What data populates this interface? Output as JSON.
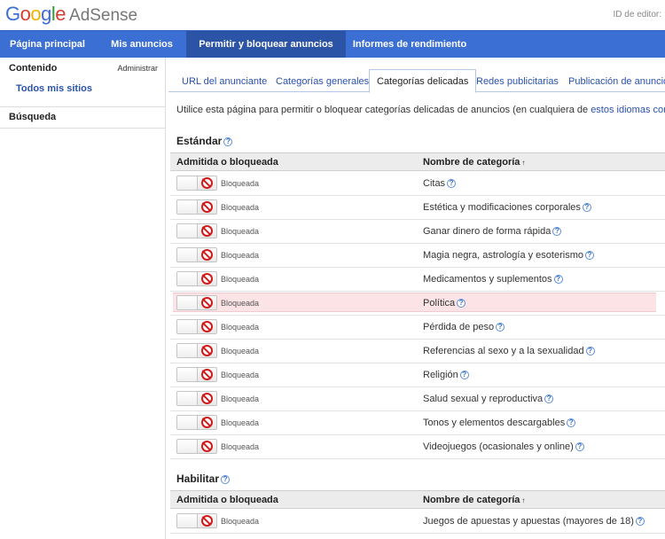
{
  "header": {
    "logo_google": [
      "G",
      "o",
      "o",
      "g",
      "l",
      "e"
    ],
    "product": "AdSense",
    "publisher_id": "ID de editor:"
  },
  "nav": {
    "items": [
      {
        "label": "Página principal"
      },
      {
        "label": "Mis anuncios"
      },
      {
        "label": "Permitir y bloquear anuncios",
        "active": true
      },
      {
        "label": "Informes de rendimiento"
      }
    ]
  },
  "sidebar": {
    "content_heading": "Contenido",
    "admin_link": "Administrar",
    "all_sites": "Todos mis sitios",
    "search_heading": "Búsqueda"
  },
  "tabs": [
    {
      "label": "URL del anunciante"
    },
    {
      "label": "Categorías generales"
    },
    {
      "label": "Categorías delicadas",
      "active": true
    },
    {
      "label": "Redes publicitarias"
    },
    {
      "label": "Publicación de anuncios"
    }
  ],
  "intro": {
    "text": "Utilice esta página para permitir o bloquear categorías delicadas de anuncios (en cualquiera de ",
    "link": "estos idiomas compatibles"
  },
  "columns": {
    "status": "Admitida o bloqueada",
    "category": "Nombre de categoría"
  },
  "sections": [
    {
      "title": "Estándar",
      "rows": [
        {
          "status": "Bloqueada",
          "category": "Citas"
        },
        {
          "status": "Bloqueada",
          "category": "Estética y modificaciones corporales"
        },
        {
          "status": "Bloqueada",
          "category": "Ganar dinero de forma rápida"
        },
        {
          "status": "Bloqueada",
          "category": "Magia negra, astrología y esoterismo"
        },
        {
          "status": "Bloqueada",
          "category": "Medicamentos y suplementos"
        },
        {
          "status": "Bloqueada",
          "category": "Política",
          "highlighted": true
        },
        {
          "status": "Bloqueada",
          "category": "Pérdida de peso"
        },
        {
          "status": "Bloqueada",
          "category": "Referencias al sexo y a la sexualidad"
        },
        {
          "status": "Bloqueada",
          "category": "Religión"
        },
        {
          "status": "Bloqueada",
          "category": "Salud sexual y reproductiva"
        },
        {
          "status": "Bloqueada",
          "category": "Tonos y elementos descargables"
        },
        {
          "status": "Bloqueada",
          "category": "Videojuegos (ocasionales y online)"
        }
      ]
    },
    {
      "title": "Habilitar",
      "rows": [
        {
          "status": "Bloqueada",
          "category": "Juegos de apuestas y apuestas (mayores de 18)"
        }
      ]
    }
  ],
  "colors": {
    "nav_bg": "#3b6fd3",
    "nav_active": "#2b53a6",
    "link": "#2a52a8",
    "highlight_row": "#fbe3e6",
    "block_icon": "#d01b1b"
  }
}
